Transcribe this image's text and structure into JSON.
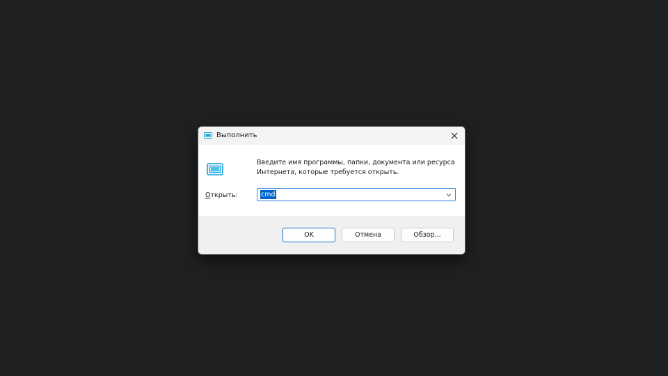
{
  "dialog": {
    "title": "Выполнить",
    "description": "Введите имя программы, папки, документа или ресурса Интернета, которые требуется открыть.",
    "open_label_prefix": "",
    "open_label_hotkey": "О",
    "open_label_rest": "ткрыть:",
    "input_value": "cmd",
    "buttons": {
      "ok": "OK",
      "cancel": "Отмена",
      "browse": "Обзор..."
    }
  },
  "icons": {
    "title": "run-icon",
    "main": "run-icon",
    "close": "close-icon",
    "dropdown": "chevron-down-icon"
  },
  "colors": {
    "desktop": "#1f2022",
    "accent": "#0063cc",
    "icon": "#1aa3d9"
  }
}
